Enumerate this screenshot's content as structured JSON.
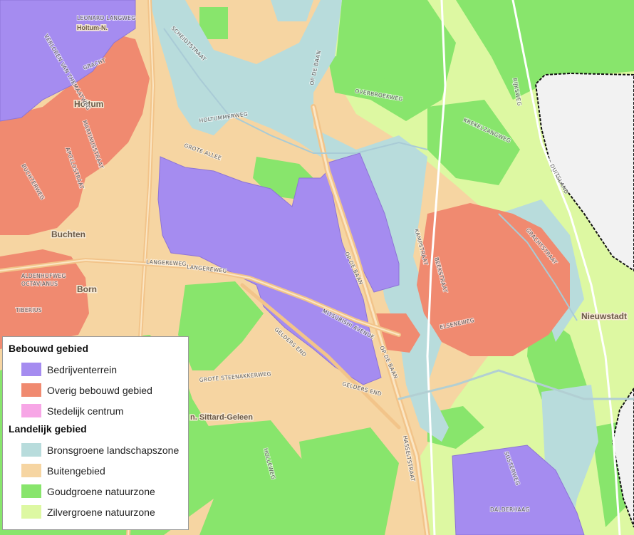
{
  "map": {
    "places": [
      {
        "id": "holtum-n",
        "name": "Holtum-N."
      },
      {
        "id": "holtum",
        "name": "Holtum"
      },
      {
        "id": "buchten",
        "name": "Buchten"
      },
      {
        "id": "born",
        "name": "Born"
      },
      {
        "id": "nieuwstadt",
        "name": "Nieuwstadt"
      },
      {
        "id": "stlb",
        "name": "n. Sittard-Geleen"
      }
    ],
    "streets": [
      {
        "id": "leonard",
        "name": "LEONARD LANGWEG"
      },
      {
        "id": "vonderen",
        "name": "VERLOREN VAN THEMAATWEG"
      },
      {
        "id": "scheidt",
        "name": "SCHEIDTSTRAAT"
      },
      {
        "id": "holtummer",
        "name": "HOLTUMMERWEG"
      },
      {
        "id": "opdebaan1",
        "name": "OP DE BAAN"
      },
      {
        "id": "opdebaan2",
        "name": "OP DE BAAN"
      },
      {
        "id": "opdebaan3",
        "name": "OP DE BAAN"
      },
      {
        "id": "langereweg",
        "name": "LANGEREWEG"
      },
      {
        "id": "langereweg2",
        "name": "LANGEREWEG"
      },
      {
        "id": "aldenhof",
        "name": "ALDENHOFWEG"
      },
      {
        "id": "mitsubishi",
        "name": "MITSUBISHI AVENUE"
      },
      {
        "id": "geldersend",
        "name": "GELDERS END"
      },
      {
        "id": "geldersend2",
        "name": "GELDERS END"
      },
      {
        "id": "hasselt",
        "name": "HASSELTSTRAAT"
      },
      {
        "id": "bachlaan",
        "name": "BEEKSTRAAT"
      },
      {
        "id": "elsenew",
        "name": "ELSENEWEG"
      },
      {
        "id": "duitsland",
        "name": "DUITSLAND"
      },
      {
        "id": "susteren",
        "name": "SUSTERWEG"
      },
      {
        "id": "dalderhaag",
        "name": "DALDERHAAG"
      },
      {
        "id": "rijksweg",
        "name": "RIJKSWEG"
      },
      {
        "id": "kreek",
        "name": "KREKELZANGWEG"
      },
      {
        "id": "apollo",
        "name": "APOLLOSTRAAT"
      },
      {
        "id": "martinus",
        "name": "MARTINUSSTRAAT"
      },
      {
        "id": "bucht",
        "name": "BUCHTERWEG"
      },
      {
        "id": "overschie",
        "name": "OVERBROEKWEG"
      },
      {
        "id": "grote",
        "name": "GROTE ALLEE"
      },
      {
        "id": "gracht",
        "name": "GRACHTSTRAAT"
      },
      {
        "id": "kamp",
        "name": "KAMPSTRAAT"
      },
      {
        "id": "tiberius",
        "name": "TIBERIUS"
      },
      {
        "id": "octavianus",
        "name": "OCTAVIANUS"
      },
      {
        "id": "steenakker",
        "name": "GROTE STEENAKKERWEG"
      },
      {
        "id": "driesch",
        "name": "GRACHT"
      },
      {
        "id": "bosweg",
        "name": "HOLLEWEG"
      }
    ]
  },
  "legend": {
    "groups": [
      {
        "title": "Bebouwd gebied",
        "items": [
          {
            "label": "Bedrijventerrein",
            "color": "#a58cf0"
          },
          {
            "label": "Overig bebouwd gebied",
            "color": "#f08a70"
          },
          {
            "label": "Stedelijk centrum",
            "color": "#f7a6e6"
          }
        ]
      },
      {
        "title": "Landelijk gebied",
        "items": [
          {
            "label": "Bronsgroene landschapszone",
            "color": "#b8dcdc"
          },
          {
            "label": "Buitengebied",
            "color": "#f6d5a2"
          },
          {
            "label": "Goudgroene natuurzone",
            "color": "#88e56c"
          },
          {
            "label": "Zilvergroene natuurzone",
            "color": "#ddf8a2"
          }
        ]
      }
    ]
  },
  "colors": {
    "buitengebied": "#f6d5a2",
    "bedrijventerrein": "#a58cf0",
    "overig_bebouwd": "#f08a70",
    "bronsgroen": "#b8dcdc",
    "goudgroen": "#88e56c",
    "zilvergroen": "#ddf8a2",
    "foreign": "#f2f2f2",
    "border": "#111111"
  }
}
